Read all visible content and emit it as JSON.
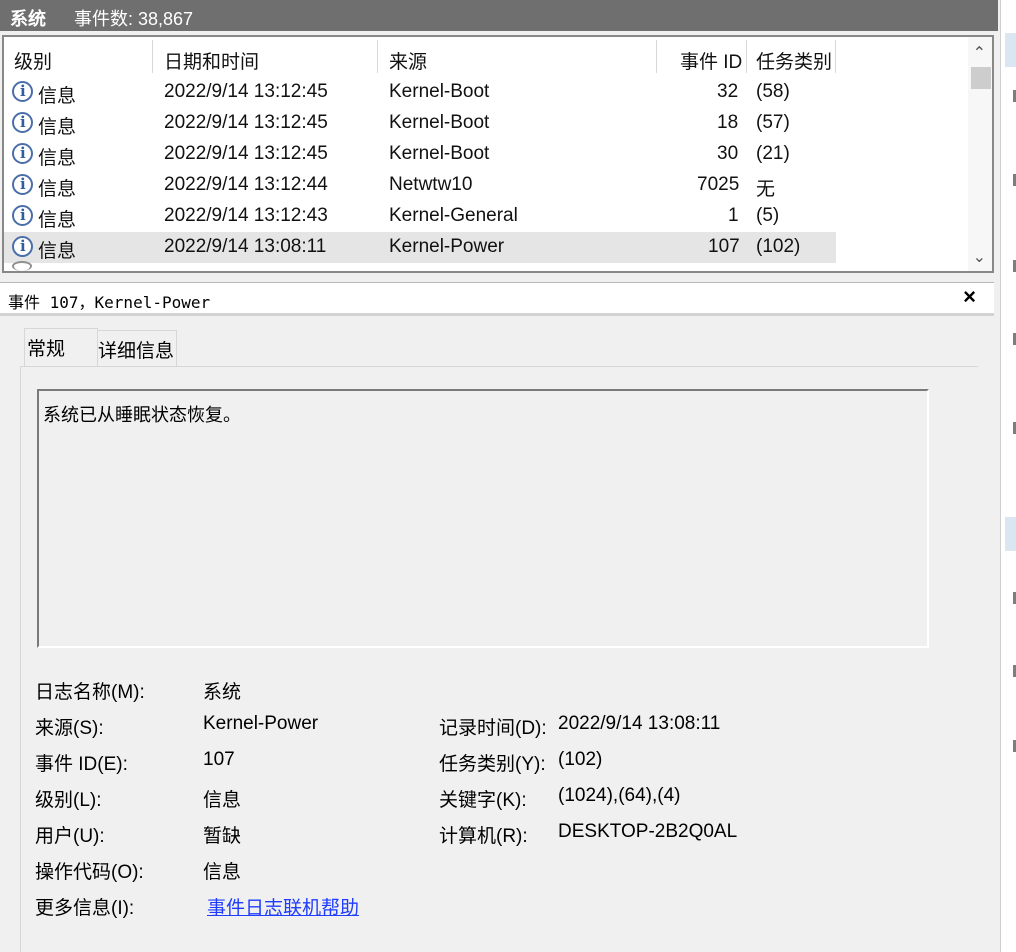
{
  "topbar": {
    "title": "系统",
    "event_count": "事件数: 38,867"
  },
  "columns": [
    "级别",
    "日期和时间",
    "来源",
    "事件 ID",
    "任务类别"
  ],
  "events": [
    {
      "level": "信息",
      "datetime": "2022/9/14 13:12:45",
      "source": "Kernel-Boot",
      "id": "32",
      "task": "(58)"
    },
    {
      "level": "信息",
      "datetime": "2022/9/14 13:12:45",
      "source": "Kernel-Boot",
      "id": "18",
      "task": "(57)"
    },
    {
      "level": "信息",
      "datetime": "2022/9/14 13:12:45",
      "source": "Kernel-Boot",
      "id": "30",
      "task": "(21)"
    },
    {
      "level": "信息",
      "datetime": "2022/9/14 13:12:44",
      "source": "Netwtw10",
      "id": "7025",
      "task": "无"
    },
    {
      "level": "信息",
      "datetime": "2022/9/14 13:12:43",
      "source": "Kernel-General",
      "id": "1",
      "task": "(5)"
    },
    {
      "level": "信息",
      "datetime": "2022/9/14 13:08:11",
      "source": "Kernel-Power",
      "id": "107",
      "task": "(102)"
    }
  ],
  "detail": {
    "title": "事件 107，Kernel-Power",
    "tabs": [
      "常规",
      "详细信息"
    ],
    "message": "系统已从睡眠状态恢复。",
    "labels": {
      "log_name": "日志名称(M):",
      "source": "来源(S):",
      "event_id": "事件 ID(E):",
      "level": "级别(L):",
      "user": "用户(U):",
      "opcode": "操作代码(O):",
      "more_info": "更多信息(I):",
      "logged": "记录时间(D):",
      "task_category": "任务类别(Y):",
      "keywords": "关键字(K):",
      "computer": "计算机(R):"
    },
    "values": {
      "log_name": "系统",
      "source": "Kernel-Power",
      "event_id": "107",
      "level": "信息",
      "user": "暂缺",
      "opcode": "信息",
      "more_info": "事件日志联机帮助",
      "logged": "2022/9/14 13:08:11",
      "task_category": "(102)",
      "keywords": "(1024),(64),(4)",
      "computer": "DESKTOP-2B2Q0AL"
    }
  },
  "icons": {
    "info": "info-icon",
    "close": "close-icon",
    "scroll_up": "chevron-up-icon",
    "scroll_down": "chevron-down-icon"
  }
}
